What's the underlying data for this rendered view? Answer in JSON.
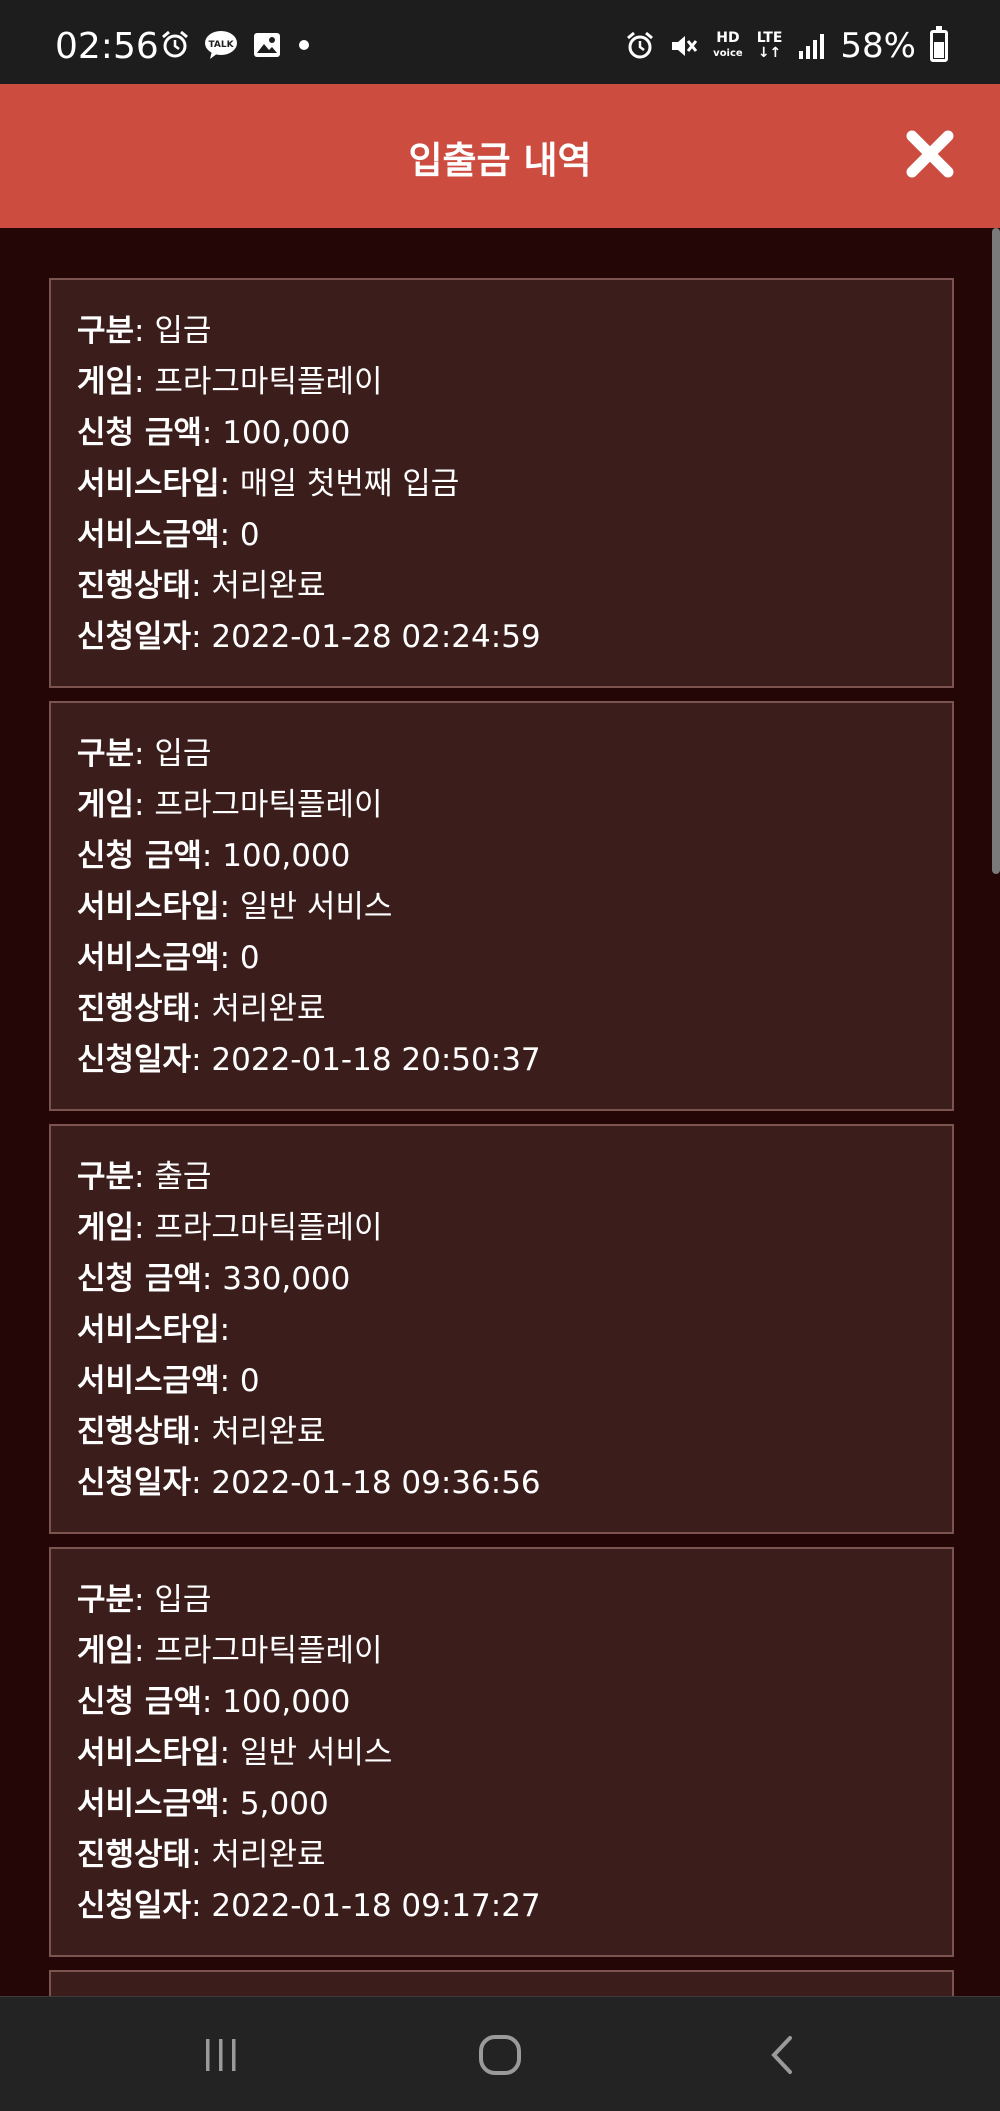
{
  "status_bar": {
    "time": "02:56",
    "battery": "58%",
    "hd_top": "HD",
    "hd_bottom": "voice",
    "lte": "LTE"
  },
  "header": {
    "title": "입출금 내역"
  },
  "labels": {
    "type": "구분",
    "game": "게임",
    "amount": "신청 금액",
    "service_type": "서비스타입",
    "service_amount": "서비스금액",
    "status": "진행상태",
    "date": "신청일자"
  },
  "transactions": [
    {
      "type": "입금",
      "game": "프라그마틱플레이",
      "amount": "100,000",
      "service_type": "매일 첫번째 입금",
      "service_amount": "0",
      "status": "처리완료",
      "date": "2022-01-28 02:24:59"
    },
    {
      "type": "입금",
      "game": "프라그마틱플레이",
      "amount": "100,000",
      "service_type": "일반 서비스",
      "service_amount": "0",
      "status": "처리완료",
      "date": "2022-01-18 20:50:37"
    },
    {
      "type": "출금",
      "game": "프라그마틱플레이",
      "amount": "330,000",
      "service_type": "",
      "service_amount": "0",
      "status": "처리완료",
      "date": "2022-01-18 09:36:56"
    },
    {
      "type": "입금",
      "game": "프라그마틱플레이",
      "amount": "100,000",
      "service_type": "일반 서비스",
      "service_amount": "5,000",
      "status": "처리완료",
      "date": "2022-01-18 09:17:27"
    }
  ],
  "colors": {
    "header": "#cc4d40",
    "background": "#230605",
    "card": "#3b1e1c",
    "card_border": "#7b5450"
  },
  "icons": {
    "close": "close-x-icon",
    "nav_recent": "recent-apps-icon",
    "nav_home": "home-icon",
    "nav_back": "back-icon"
  }
}
